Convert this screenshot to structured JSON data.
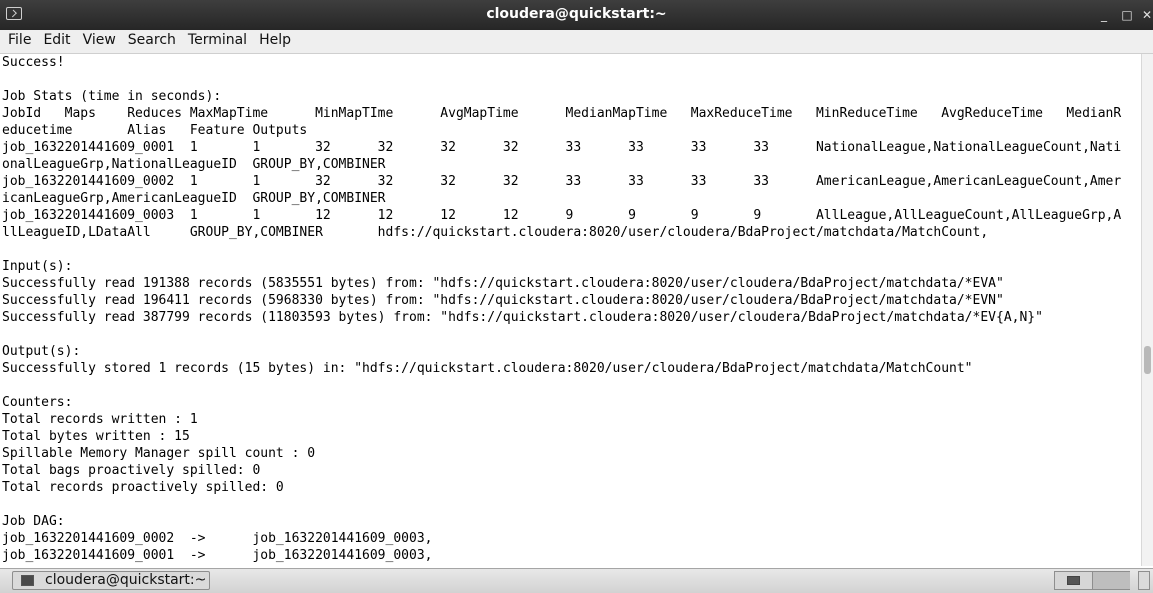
{
  "window": {
    "title": "cloudera@quickstart:~",
    "minimize": "_",
    "maximize": "□",
    "close": "✕"
  },
  "menu": [
    "File",
    "Edit",
    "View",
    "Search",
    "Terminal",
    "Help"
  ],
  "terminal_lines": [
    "Success!",
    "",
    "Job Stats (time in seconds):",
    "JobId   Maps    Reduces MaxMapTime      MinMapTIme      AvgMapTime      MedianMapTime   MaxReduceTime   MinReduceTime   AvgReduceTime   MedianR",
    "educetime       Alias   Feature Outputs",
    "job_1632201441609_0001  1       1       32      32      32      32      33      33      33      33      NationalLeague,NationalLeagueCount,Nati",
    "onalLeagueGrp,NationalLeagueID  GROUP_BY,COMBINER",
    "job_1632201441609_0002  1       1       32      32      32      32      33      33      33      33      AmericanLeague,AmericanLeagueCount,Amer",
    "icanLeagueGrp,AmericanLeagueID  GROUP_BY,COMBINER",
    "job_1632201441609_0003  1       1       12      12      12      12      9       9       9       9       AllLeague,AllLeagueCount,AllLeagueGrp,A",
    "llLeagueID,LDataAll     GROUP_BY,COMBINER       hdfs://quickstart.cloudera:8020/user/cloudera/BdaProject/matchdata/MatchCount,",
    "",
    "Input(s):",
    "Successfully read 191388 records (5835551 bytes) from: \"hdfs://quickstart.cloudera:8020/user/cloudera/BdaProject/matchdata/*EVA\"",
    "Successfully read 196411 records (5968330 bytes) from: \"hdfs://quickstart.cloudera:8020/user/cloudera/BdaProject/matchdata/*EVN\"",
    "Successfully read 387799 records (11803593 bytes) from: \"hdfs://quickstart.cloudera:8020/user/cloudera/BdaProject/matchdata/*EV{A,N}\"",
    "",
    "Output(s):",
    "Successfully stored 1 records (15 bytes) in: \"hdfs://quickstart.cloudera:8020/user/cloudera/BdaProject/matchdata/MatchCount\"",
    "",
    "Counters:",
    "Total records written : 1",
    "Total bytes written : 15",
    "Spillable Memory Manager spill count : 0",
    "Total bags proactively spilled: 0",
    "Total records proactively spilled: 0",
    "",
    "Job DAG:",
    "job_1632201441609_0002  ->      job_1632201441609_0003,",
    "job_1632201441609_0001  ->      job_1632201441609_0003,"
  ],
  "taskbar": {
    "task_label": "cloudera@quickstart:~"
  }
}
